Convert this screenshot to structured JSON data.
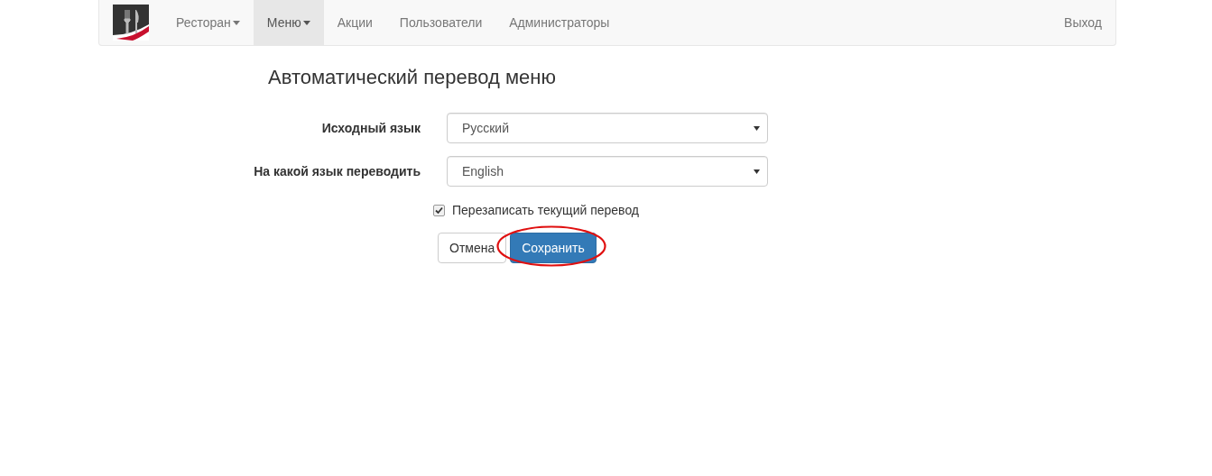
{
  "navbar": {
    "items": [
      {
        "label": "Ресторан",
        "dropdown": true,
        "selected": false
      },
      {
        "label": "Меню",
        "dropdown": true,
        "selected": true
      },
      {
        "label": "Акции",
        "dropdown": false,
        "selected": false
      },
      {
        "label": "Пользователи",
        "dropdown": false,
        "selected": false
      },
      {
        "label": "Администраторы",
        "dropdown": false,
        "selected": false
      }
    ],
    "logout": "Выход"
  },
  "page": {
    "title": "Автоматический перевод меню",
    "fields": [
      {
        "label": "Исходный язык",
        "value": "Русский"
      },
      {
        "label": "На какой язык переводить",
        "value": "English"
      }
    ],
    "overwrite": {
      "label": "Перезаписать текущий перевод",
      "checked": true
    },
    "buttons": [
      {
        "label": "Отмена",
        "kind": "default",
        "annotated": false
      },
      {
        "label": "Сохранить",
        "kind": "primary",
        "annotated": true
      }
    ]
  }
}
